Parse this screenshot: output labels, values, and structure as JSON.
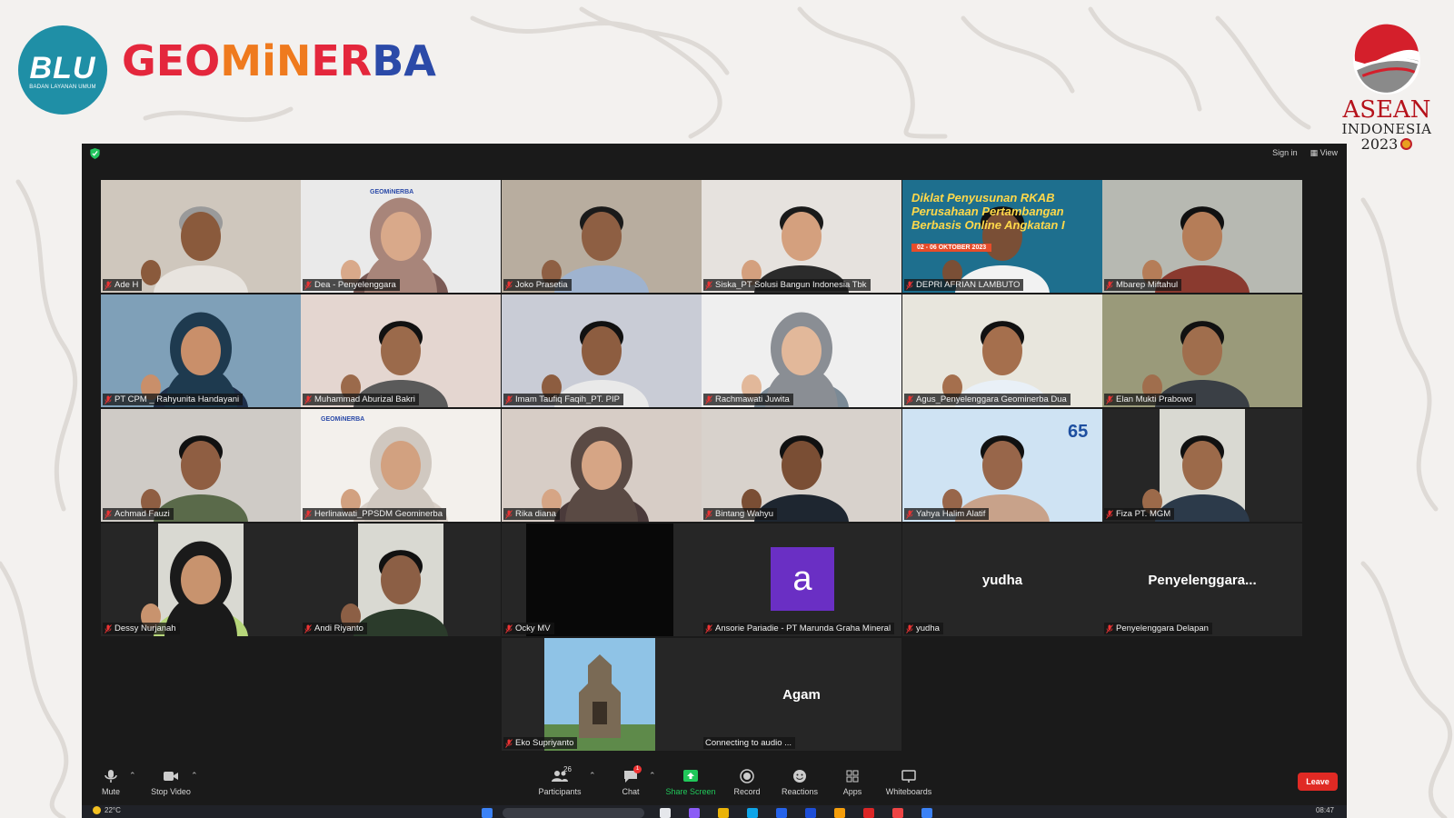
{
  "branding": {
    "blu_mark": "BLU",
    "blu_subtitle": "BADAN LAYANAN UMUM",
    "brand_part1": "GEO",
    "brand_part2": "MiN",
    "brand_part3": "ER",
    "brand_part4": "BA",
    "asean_line1": "ASEAN",
    "asean_line2": "INDONESIA",
    "asean_line3": "2023"
  },
  "topbar": {
    "sign_in": "Sign in",
    "view": "View"
  },
  "participants": [
    {
      "name": "Ade H"
    },
    {
      "name": "Dea - Penyelenggara"
    },
    {
      "name": "Joko Prasetia"
    },
    {
      "name": "Siska_PT Solusi Bangun Indonesia Tbk"
    },
    {
      "name": "DEPRI AFRIAN LAMBUTO"
    },
    {
      "name": "Mbarep Miftahul"
    },
    {
      "name": "PT CPM _ Rahyunita Handayani"
    },
    {
      "name": "Muhammad Aburizal Bakri"
    },
    {
      "name": "Imam Taufiq Faqih_PT. PIP"
    },
    {
      "name": "Rachmawati Juwita"
    },
    {
      "name": "Agus_Penyelenggara Geominerba Dua"
    },
    {
      "name": "Elan Mukti Prabowo"
    },
    {
      "name": "Achmad Fauzi"
    },
    {
      "name": "Herlinawati_PPSDM Geominerba"
    },
    {
      "name": "Rika diana"
    },
    {
      "name": "Bintang Wahyu"
    },
    {
      "name": "Yahya Halim Alatif"
    },
    {
      "name": "Fiza PT. MGM"
    },
    {
      "name": "Dessy Nurjanah"
    },
    {
      "name": "Andi Riyanto"
    },
    {
      "name": "Ocky MV"
    },
    {
      "name": "Ansorie Pariadie - PT Marunda Graha Mineral",
      "avatar_letter": "a"
    },
    {
      "name": "yudha",
      "display": "yudha"
    },
    {
      "name": "Penyelenggara Delapan",
      "display": "Penyelenggara..."
    },
    {
      "name": "Eko Supriyanto"
    },
    {
      "name": "Connecting to audio ...",
      "display": "Agam"
    }
  ],
  "tile_texts": {
    "depri_banner": "Diklat Penyusunan RKAB Perusahaan Pertambangan Berbasis Online Angkatan I",
    "depri_date": "02 - 06 OKTOBER 2023",
    "dea_bg": "GEOMiNERBA",
    "herlina_bg": "GEOMiNERBA",
    "yahya_bg": "65"
  },
  "toolbar": {
    "mute": "Mute",
    "stop_video": "Stop Video",
    "participants": "Participants",
    "participants_count": "26",
    "chat": "Chat",
    "chat_badge": "1",
    "share_screen": "Share Screen",
    "record": "Record",
    "reactions": "Reactions",
    "apps": "Apps",
    "whiteboards": "Whiteboards",
    "leave": "Leave"
  },
  "taskbar": {
    "temperature": "22°C",
    "time": "08:47"
  },
  "colors": {
    "window_bg": "#1a1a1a",
    "tile_bg": "#262626",
    "active_speaker": "#e5e25a",
    "leave": "#e02a24",
    "share": "#21c85a",
    "brand_red": "#e4273c",
    "brand_orange": "#ef7a1e",
    "brand_blue": "#2b4aa8",
    "blu_teal": "#1f8fa6"
  }
}
